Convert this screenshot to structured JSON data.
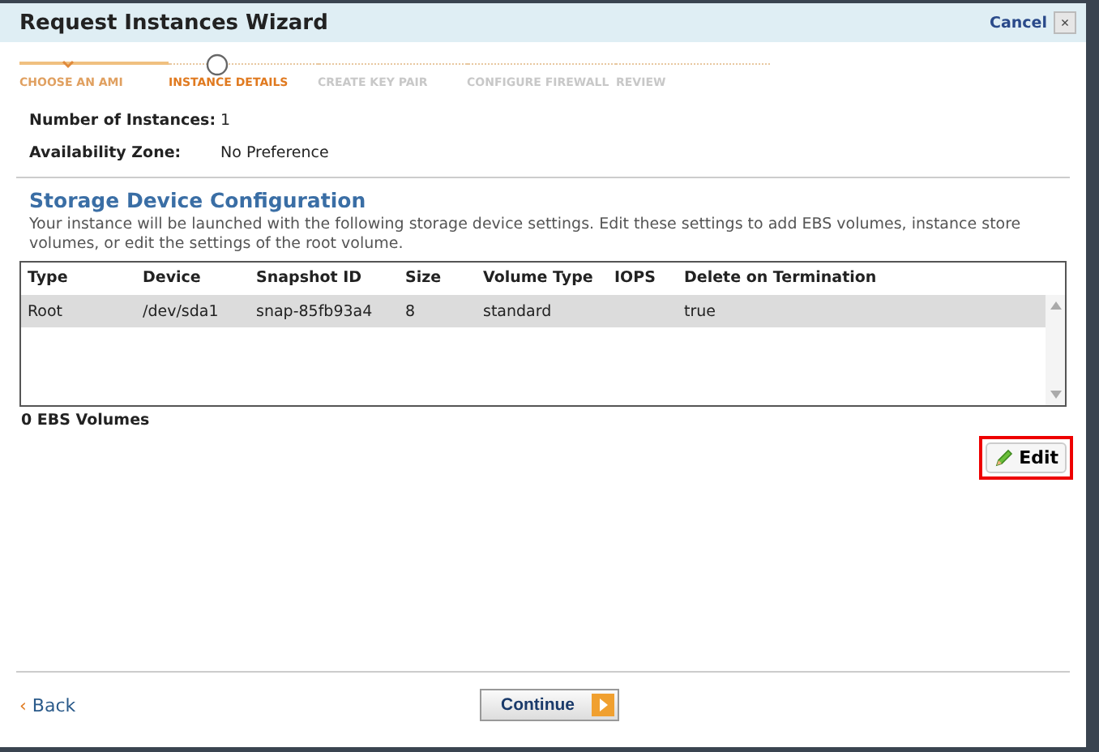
{
  "window": {
    "title": "Request Instances Wizard",
    "cancel": "Cancel",
    "close": "×"
  },
  "steps": [
    {
      "label": "CHOOSE AN AMI",
      "done": true,
      "selected": false
    },
    {
      "label": "INSTANCE DETAILS",
      "done": false,
      "selected": true
    },
    {
      "label": "CREATE KEY PAIR",
      "done": false,
      "selected": false
    },
    {
      "label": "CONFIGURE FIREWALL",
      "done": false,
      "selected": false
    },
    {
      "label": "REVIEW",
      "done": false,
      "selected": false
    }
  ],
  "fields": [
    {
      "label": "Number of Instances:",
      "value": "1"
    },
    {
      "label": "Availability Zone:",
      "value": "No Preference"
    }
  ],
  "section": {
    "title": "Storage Device Configuration",
    "description": "Your instance will be launched with the following storage device settings. Edit these settings to add EBS volumes, instance store volumes, or edit the settings of the root volume."
  },
  "table": {
    "columns": [
      "Type",
      "Device",
      "Snapshot ID",
      "Size",
      "Volume Type",
      "IOPS",
      "Delete on Termination"
    ],
    "rows": [
      {
        "cells": [
          "Root",
          "/dev/sda1",
          "snap-85fb93a4",
          "8",
          "standard",
          "",
          "true"
        ],
        "selected": true
      }
    ]
  },
  "ebs_count": "0 EBS Volumes",
  "edit_button": {
    "label": "Edit",
    "highlighted": true
  },
  "footer": {
    "back_arrow": "‹",
    "back": "Back",
    "continue": "Continue"
  }
}
